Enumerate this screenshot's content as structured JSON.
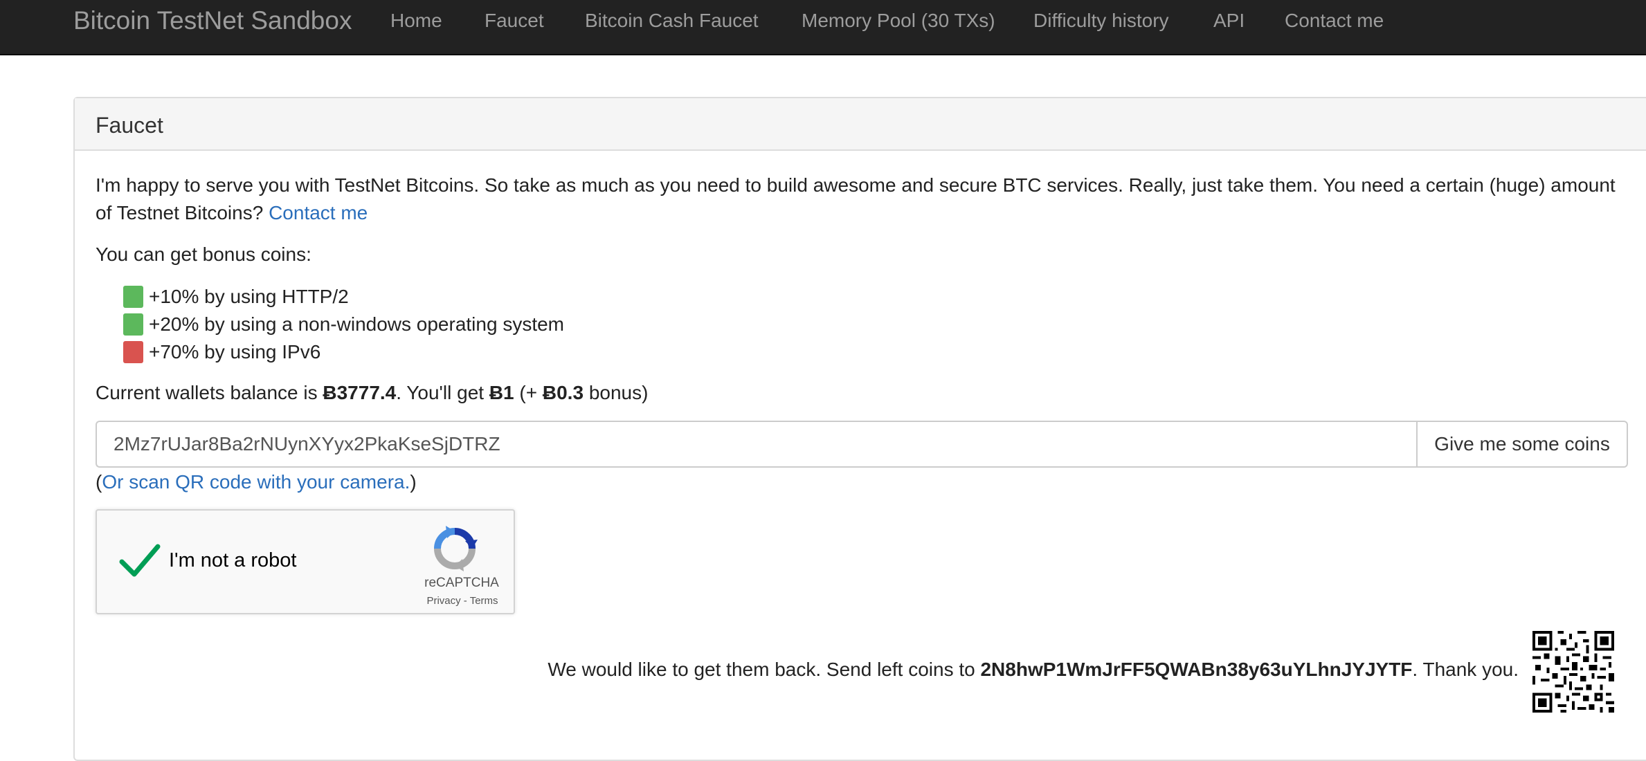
{
  "navbar": {
    "brand": "Bitcoin TestNet Sandbox",
    "items": [
      {
        "label": "Home"
      },
      {
        "label": "Faucet"
      },
      {
        "label": "Bitcoin Cash Faucet"
      },
      {
        "label": "Memory Pool (30 TXs)"
      },
      {
        "label": "Difficulty history"
      },
      {
        "label": "API"
      },
      {
        "label": "Contact me"
      }
    ]
  },
  "panel": {
    "title": "Faucet",
    "intro_line1": "I'm happy to serve you with TestNet Bitcoins. So take as much as you need to build awesome and secure BTC services. Really, just take them. You need a certain (huge) amount",
    "intro_line2": "of Testnet Bitcoins?",
    "contact_link": "Contact me",
    "bonus_heading": "You can get bonus coins:",
    "bonuses": [
      {
        "text": "+10% by using HTTP/2",
        "status": "active",
        "color": "#5cb85c"
      },
      {
        "text": "+20% by using a non-windows operating system",
        "status": "active",
        "color": "#5cb85c"
      },
      {
        "text": "+70% by using IPv6",
        "status": "inactive",
        "color": "#d9534f"
      }
    ],
    "balance": {
      "prefix": "Current wallets balance is",
      "amount": "Ƀ3777.4",
      "middle": ". You'll get",
      "get_amount": "Ƀ1",
      "bonus_open": "(+",
      "bonus_amount": "Ƀ0.3",
      "bonus_close": "bonus)"
    },
    "address_input_value": "2Mz7rUJar8Ba2rNUynXYyx2PkaKseSjDTRZ",
    "give_button": "Give me some coins",
    "qr_hint_open": "(",
    "qr_hint_link": "Or scan QR code with your camera.",
    "qr_hint_close": ")",
    "captcha": {
      "label": "I'm not a robot",
      "brand": "reCAPTCHA",
      "privacy": "Privacy",
      "separator": " - ",
      "terms": "Terms",
      "checked": true
    },
    "return": {
      "prefix": "We would like to get them back. Send left coins to",
      "address": "2N8hwP1WmJrFF5QWABn38y63uYLhnJYJYTF",
      "suffix": ". Thank you."
    }
  },
  "colors": {
    "navbar_bg": "#222222",
    "nav_text": "#9d9d9d",
    "link": "#2a6ebb",
    "success": "#5cb85c",
    "danger": "#d9534f",
    "recaptcha_check": "#009e55"
  },
  "icons": [
    "checkmark-icon",
    "recaptcha-logo-icon",
    "qr-code-icon"
  ]
}
